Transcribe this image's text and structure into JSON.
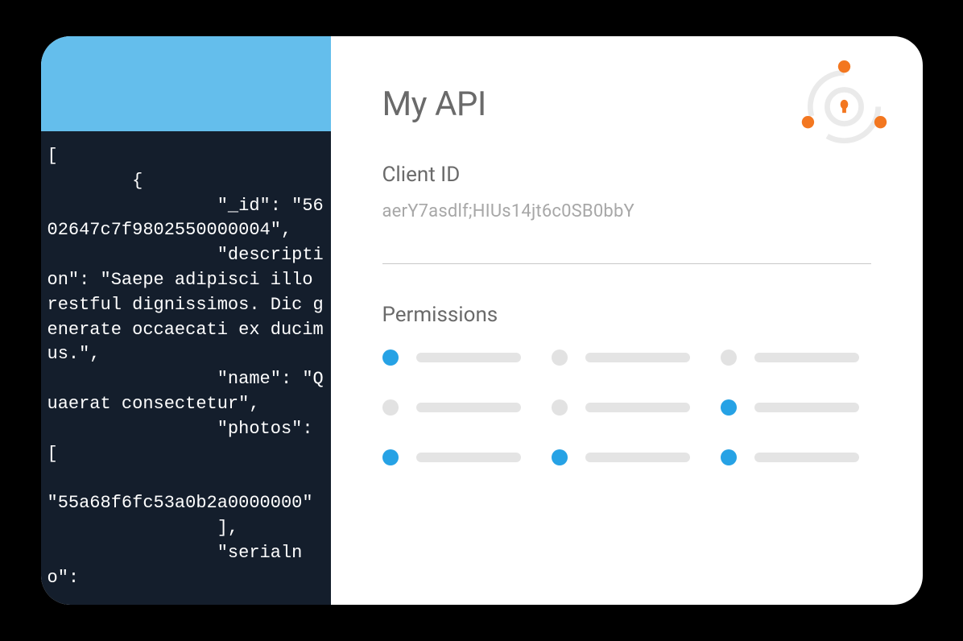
{
  "code_panel": {
    "json_text": "[\n        {\n                \"_id\": \"5602647c7f9802550000004\",\n                \"description\": \"Saepe adipisci illo restful dignissimos. Dic generate occaecati ex ducimus.\",\n                \"name\": \"Quaerat consectetur\",\n                \"photos\": [\n\n\"55a68f6fc53a0b2a0000000\"\n                ],\n                \"serialno\":"
  },
  "api": {
    "title": "My API",
    "client_id_label": "Client ID",
    "client_id_value": "aerY7asdlf;HIUs14jt6c0SB0bbY",
    "permissions_label": "Permissions",
    "permissions": [
      {
        "active": true
      },
      {
        "active": false
      },
      {
        "active": false
      },
      {
        "active": false
      },
      {
        "active": false
      },
      {
        "active": true
      },
      {
        "active": true
      },
      {
        "active": true
      },
      {
        "active": true
      }
    ]
  },
  "colors": {
    "accent_blue": "#26a2e5",
    "accent_orange": "#f37720",
    "code_bg": "#141e2c",
    "header_bg": "#64beec"
  }
}
